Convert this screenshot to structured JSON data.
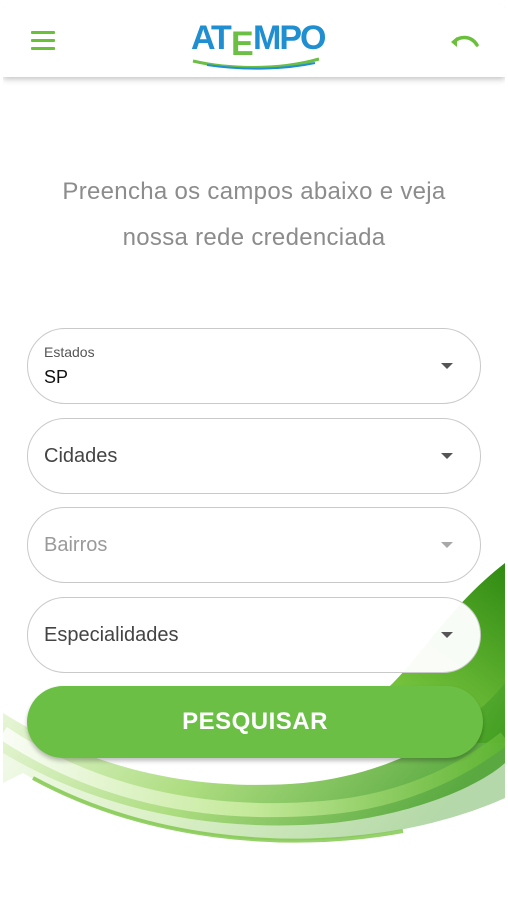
{
  "app": {
    "logo_text": "ATEMPO"
  },
  "headline": {
    "line1": "Preencha os campos abaixo e veja",
    "line2": "nossa rede credenciada"
  },
  "form": {
    "estados": {
      "label": "Estados",
      "value": "SP"
    },
    "cidades": {
      "placeholder": "Cidades"
    },
    "bairros": {
      "placeholder": "Bairros"
    },
    "especialidades": {
      "placeholder": "Especialidades"
    }
  },
  "search_button": {
    "label": "PESQUISAR"
  },
  "colors": {
    "accent_green": "#6bbf45",
    "logo_blue": "#1f8fd1",
    "text_gray": "#8c8c8c"
  },
  "icons": {
    "menu": "hamburger-menu-icon",
    "back": "undo-arrow-icon",
    "dropdown": "caret-down-icon"
  }
}
